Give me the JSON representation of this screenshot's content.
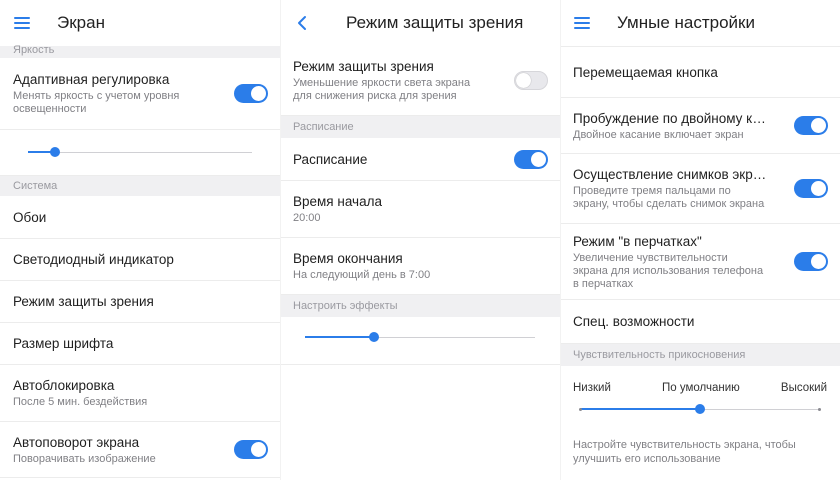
{
  "screen1": {
    "title": "Экран",
    "sec_brightness": "Яркость",
    "adaptive_label": "Адаптивная регулировка",
    "adaptive_sub": "Менять яркость с учетом уровня освещенности",
    "adaptive_on": true,
    "brightness_level": 0.12,
    "sec_system": "Система",
    "items": {
      "wallpaper": "Обои",
      "led": "Светодиодный индикатор",
      "eye": "Режим защиты зрения",
      "font": "Размер шрифта",
      "autolock": "Автоблокировка",
      "autolock_sub": "После 5 мин. бездействия",
      "rotate": "Автоповорот экрана",
      "rotate_sub": "Поворачивать изображение"
    },
    "rotate_on": true
  },
  "screen2": {
    "title": "Режим защиты зрения",
    "eye_label": "Режим защиты зрения",
    "eye_sub": "Уменьшение яркости света экрана для снижения риска для зрения",
    "eye_on": false,
    "sec_schedule": "Расписание",
    "schedule_label": "Расписание",
    "schedule_on": true,
    "start_label": "Время начала",
    "start_value": "20:00",
    "end_label": "Время окончания",
    "end_value": "На следующий день в 7:00",
    "sec_effects": "Настроить эффекты",
    "effect_level": 0.3
  },
  "screen3": {
    "title": "Умные настройки",
    "floating": "Перемещаемая кнопка",
    "double_tap_label": "Пробуждение по двойному касани..",
    "double_tap_sub": "Двойное касание включает экран",
    "double_tap_on": true,
    "screenshot_label": "Осуществление снимков экрана ж..",
    "screenshot_sub": "Проведите тремя пальцами по экрану, чтобы сделать снимок экрана",
    "screenshot_on": true,
    "gloves_label": "Режим \"в перчатках\"",
    "gloves_sub": "Увеличение чувствительности экрана для использования телефона в перчатках",
    "gloves_on": true,
    "accessibility": "Спец. возможности",
    "sec_sensitivity": "Чувствительность прикосновения",
    "low": "Низкий",
    "default": "По умолчанию",
    "high": "Высокий",
    "sensitivity_level": 0.5,
    "helper": "Настройте чувствительность экрана, чтобы улучшить его использование"
  },
  "colors": {
    "accent": "#2b7de9",
    "section_bg": "#f0f0f2"
  }
}
